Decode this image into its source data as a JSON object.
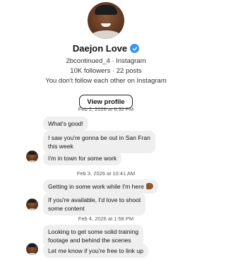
{
  "profile": {
    "name": "Daejon Love",
    "handle_line": "2bcontinued_4 · Instagram",
    "stats_line": "10K followers · 22 posts",
    "follow_note": "You don't follow each other on Instagram",
    "view_profile_label": "View profile",
    "verified": true
  },
  "thread": {
    "timestamps": [
      "Feb 2, 2026 at 6:32 PM",
      "Feb 3, 2026 at 10:41 AM",
      "Feb 4, 2026 at 1:58 PM"
    ],
    "messages": [
      {
        "text": "What's good!"
      },
      {
        "lines": [
          "I saw you're gonna be out in San Fran",
          "this week"
        ]
      },
      {
        "text": "I'm in town for some work"
      },
      {
        "text": "Getting in some work while I'm here",
        "emoji": "flexed-biceps-icon"
      },
      {
        "lines": [
          "If you're available, I'd love to shoot",
          "some content"
        ]
      },
      {
        "lines": [
          "Looking to get some solid training",
          "footage and behind the scenes"
        ]
      },
      {
        "text": "Let me know if you're free to link up"
      }
    ]
  },
  "colors": {
    "bubble": "#efefef",
    "verified": "#3897f0",
    "timestamp": "#555555"
  }
}
